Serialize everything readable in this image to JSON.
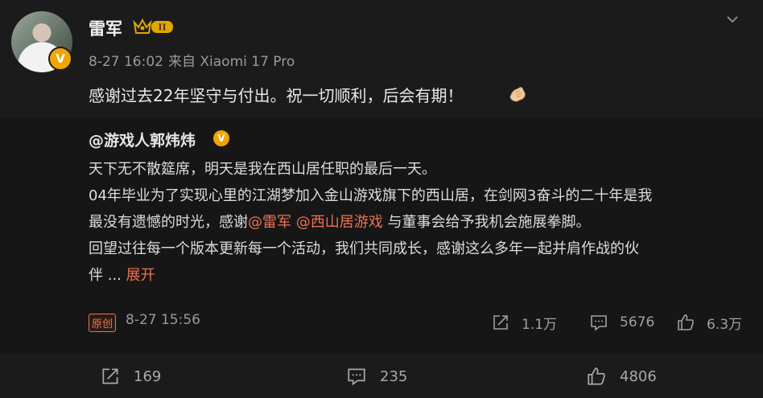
{
  "post": {
    "user": {
      "name": "雷军",
      "verified_mark": "V",
      "level_badge": "II"
    },
    "time": "8-27 16:02",
    "source": "来自 Xiaomi 17 Pro",
    "text": "感谢过去22年坚守与付出。祝一切顺利，后会有期！",
    "emoji_icon": "handshake-emoji",
    "menu_icon": "chevron-down-icon"
  },
  "repost": {
    "user_name": "@游戏人郭炜炜",
    "verified_mark": "V",
    "line1": "天下无不散筵席，明天是我在西山居任职的最后一天。",
    "line2": "04年毕业为了实现心里的江湖梦加入金山游戏旗下的西山居，在剑网3奋斗的二十年是我",
    "line3_pre": "最没有遗憾的时光，感谢",
    "mention1": "@雷军",
    "mention2": "@西山居游戏",
    "line3_post": " 与董事会给予我机会施展拳脚。",
    "line4": "回望过往每一个版本更新每一个活动，我们共同成长，感谢这么多年一起并肩作战的伙",
    "line5": "伴 ...",
    "expand": "展开",
    "tag": "原创",
    "time": "8-27 15:56",
    "stats": {
      "forward": "1.1万",
      "comment": "5676",
      "like": "6.3万"
    }
  },
  "bottom": {
    "forward": "169",
    "comment": "235",
    "like": "4806"
  },
  "colors": {
    "background": "#1b1b1b",
    "repost_bg": "#161616",
    "link": "#eb7350",
    "badge": "#f2a400"
  }
}
